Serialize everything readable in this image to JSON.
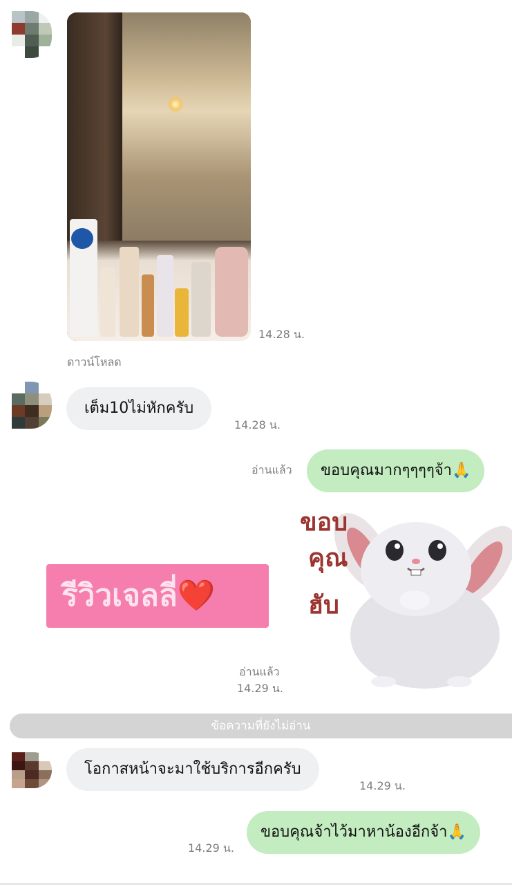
{
  "messages": [
    {
      "id": "photo",
      "time": "14.28 น.",
      "caption": "ดาวน์โหลด"
    },
    {
      "id": "in1",
      "text": "เต็ม10ไม่หักครับ",
      "time": "14.28 น."
    },
    {
      "id": "out1",
      "read": "อ่านแล้ว",
      "text": "ขอบคุณมากๆๆๆๆจ้า🙏"
    },
    {
      "id": "stickers",
      "pink_text": "รีวิวเจลลี่❤️",
      "bunny_words": [
        "ขอบ",
        "คุณ",
        "ฮับ"
      ],
      "read": "อ่านแล้ว",
      "time": "14.29 น."
    },
    {
      "id": "in2",
      "text": "โอกาสหน้าจะมาใช้บริการอีกครับ",
      "time": "14.29 น."
    },
    {
      "id": "out2",
      "text": "ขอบคุณจ้าไว้มาหาน้องอีกจ้า🙏",
      "time": "14.29 น."
    }
  ],
  "unread_divider": "ข้อความที่ยังไม่อ่าน",
  "colors": {
    "incoming_bubble": "#eff0f2",
    "outgoing_bubble": "#c3ecc0",
    "sticker_pink": "#f57eaf",
    "bunny_text": "#9c3430"
  }
}
